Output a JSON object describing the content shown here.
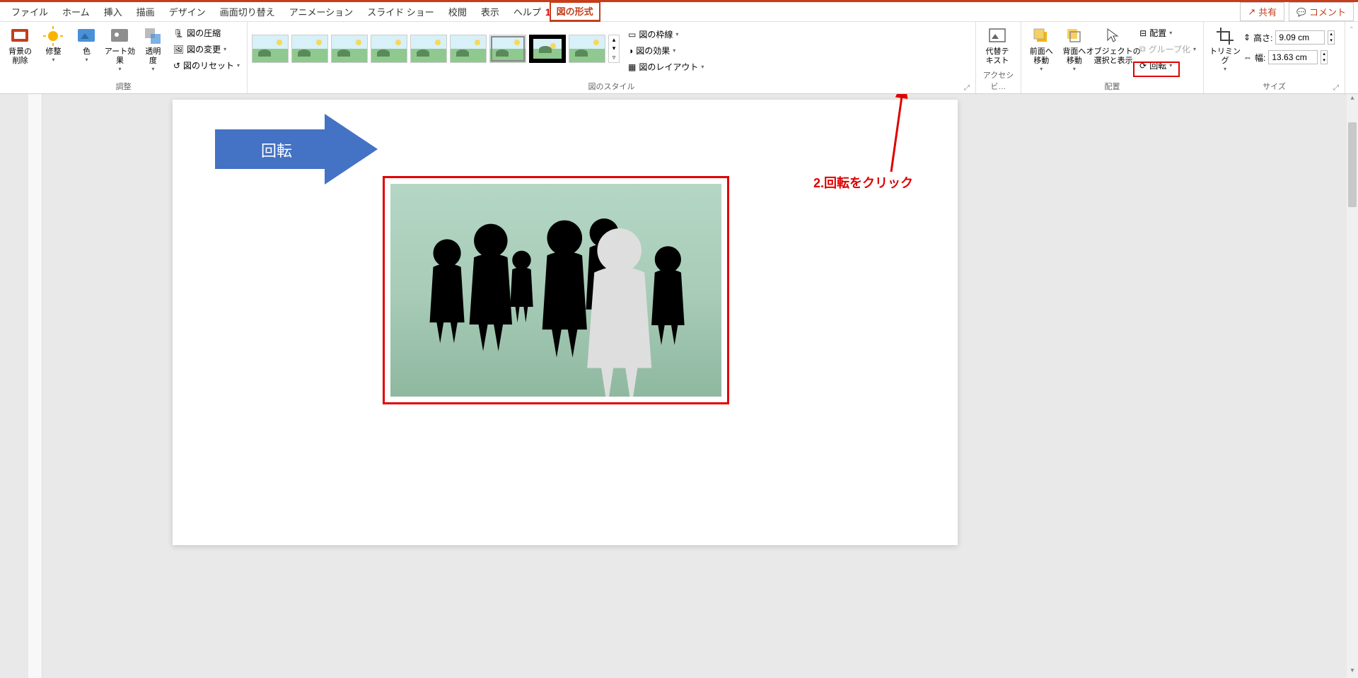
{
  "menubar": {
    "tabs": [
      "ファイル",
      "ホーム",
      "挿入",
      "描画",
      "デザイン",
      "画面切り替え",
      "アニメーション",
      "スライド ショー",
      "校閲",
      "表示",
      "ヘルプ",
      "図の形式"
    ],
    "active": 11,
    "share": "共有",
    "comment": "コメント"
  },
  "ribbon": {
    "adjust": {
      "bg_remove": "背景の\n削除",
      "corrections": "修整",
      "color": "色",
      "artistic": "アート効果",
      "transparency": "透明\n度",
      "compress": "図の圧縮",
      "change": "図の変更",
      "reset": "図のリセット",
      "label": "調整"
    },
    "styles": {
      "border": "図の枠線",
      "effects": "図の効果",
      "layout": "図のレイアウト",
      "label": "図のスタイル"
    },
    "access": {
      "alt_text": "代替テ\nキスト",
      "label": "アクセシビ…"
    },
    "arrange": {
      "bring_forward": "前面へ\n移動",
      "send_backward": "背面へ\n移動",
      "selection": "オブジェクトの\n選択と表示",
      "align": "配置",
      "group": "グループ化",
      "rotate": "回転",
      "label": "配置"
    },
    "size": {
      "crop": "トリミング",
      "height_label": "高さ:",
      "height_value": "9.09 cm",
      "width_label": "幅:",
      "width_value": "13.63 cm",
      "label": "サイズ"
    }
  },
  "slide": {
    "arrow_text": "回転"
  },
  "annotations": {
    "num1": "1",
    "step2": "2.回転をクリック"
  }
}
